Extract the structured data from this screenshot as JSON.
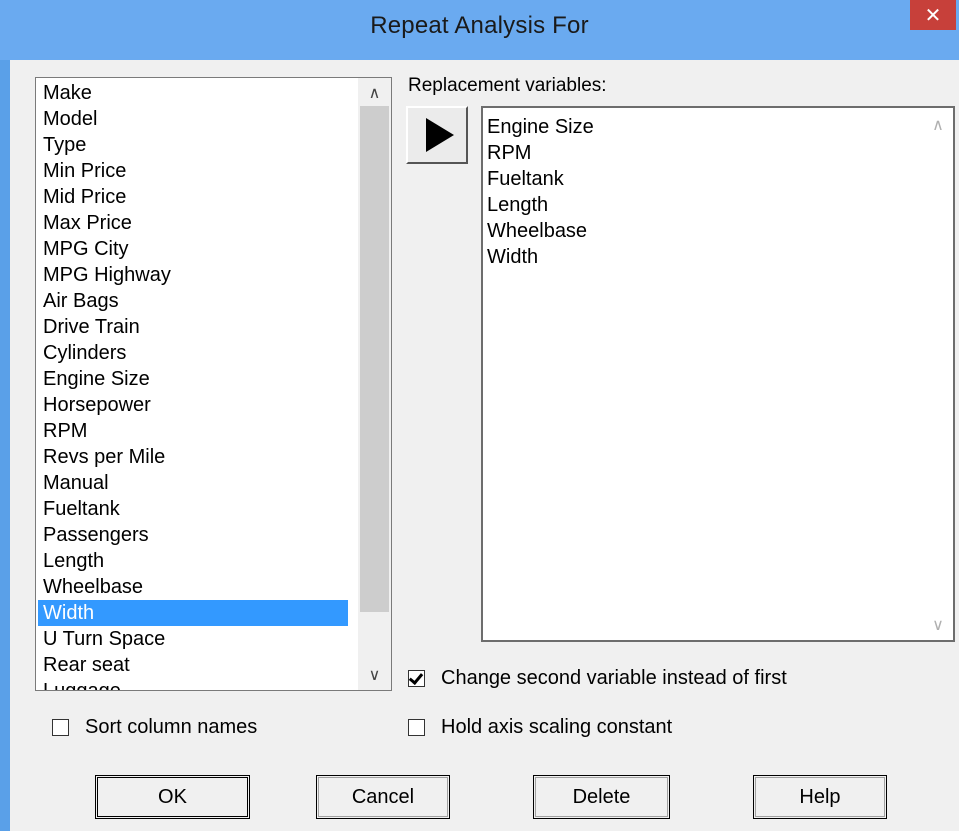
{
  "window": {
    "title": "Repeat Analysis For",
    "close_glyph": "✕"
  },
  "columns_list": {
    "items": [
      "Make",
      "Model",
      "Type",
      "Min Price",
      "Mid Price",
      "Max Price",
      "MPG City",
      "MPG Highway",
      "Air Bags",
      "Drive Train",
      "Cylinders",
      "Engine Size",
      "Horsepower",
      "RPM",
      "Revs per Mile",
      "Manual",
      "Fueltank",
      "Passengers",
      "Length",
      "Wheelbase",
      "Width",
      "U Turn Space",
      "Rear seat",
      "Luggage"
    ],
    "selected": "Width",
    "scroll_up_glyph": "∧",
    "scroll_down_glyph": "∨"
  },
  "sort_columns": {
    "label": "Sort column names",
    "checked": false
  },
  "replacement": {
    "label": "Replacement variables:",
    "items": [
      "Engine Size",
      "RPM",
      "Fueltank",
      "Length",
      "Wheelbase",
      "Width"
    ],
    "scroll_up_glyph": "∧",
    "scroll_down_glyph": "∨"
  },
  "change_second": {
    "label": "Change second variable instead of first",
    "checked": true
  },
  "hold_axis": {
    "label": "Hold axis scaling constant",
    "checked": false
  },
  "buttons": {
    "ok": "OK",
    "cancel": "Cancel",
    "delete": "Delete",
    "help": "Help"
  },
  "colors": {
    "title_bar": "#6aaaf0",
    "selection": "#3399ff",
    "close": "#c7403a",
    "dialog_bg": "#f0f0f0"
  }
}
